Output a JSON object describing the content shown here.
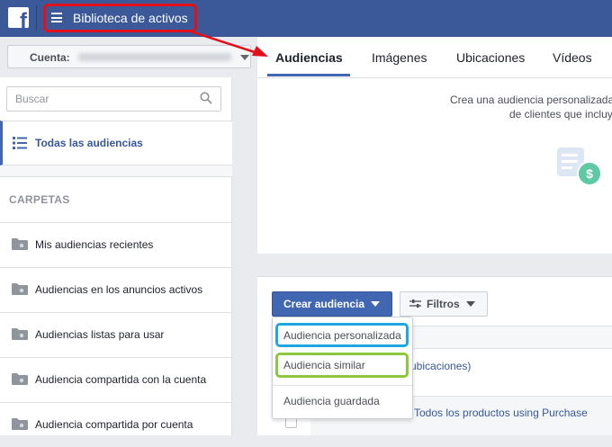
{
  "topbar": {
    "logo": "f",
    "menu_title": "Biblioteca de activos",
    "brand_color": "#3b5998"
  },
  "account": {
    "label": "Cuenta:"
  },
  "tabs": [
    {
      "label": "Audiencias",
      "active": true
    },
    {
      "label": "Imágenes",
      "active": false
    },
    {
      "label": "Ubicaciones",
      "active": false
    },
    {
      "label": "Vídeos",
      "active": false
    }
  ],
  "sidebar": {
    "search_placeholder": "Buscar",
    "all_audiences": "Todas las audiencias",
    "folders_header": "CARPETAS",
    "folders": [
      {
        "label": "Mis audiencias recientes",
        "icon": "folder-icon"
      },
      {
        "label": "Audiencias en los anuncios activos",
        "icon": "folder-icon"
      },
      {
        "label": "Audiencias listas para usar",
        "icon": "folder-icon"
      },
      {
        "label": "Audiencia compartida con la cuenta",
        "icon": "folder-icon"
      },
      {
        "label": "Audiencia compartida por cuenta",
        "icon": "folder-icon"
      }
    ]
  },
  "promo": {
    "line1": "Crea una audiencia personalizada",
    "line2": "de clientes que incluy"
  },
  "toolbar": {
    "create_label": "Crear audiencia",
    "filters_label": "Filtros"
  },
  "dropdown": {
    "items": [
      "Audiencia personalizada",
      "Audiencia similar",
      "Audiencia guardada"
    ]
  },
  "table": {
    "row1_text": "ubicaciones)",
    "row2_text": "Todos los productos using Purchase"
  },
  "colors": {
    "accent": "#4267b2",
    "link": "#365899",
    "highlight_red": "#e3101b",
    "highlight_blue": "#1ea7e0",
    "highlight_green": "#8dc63f"
  }
}
